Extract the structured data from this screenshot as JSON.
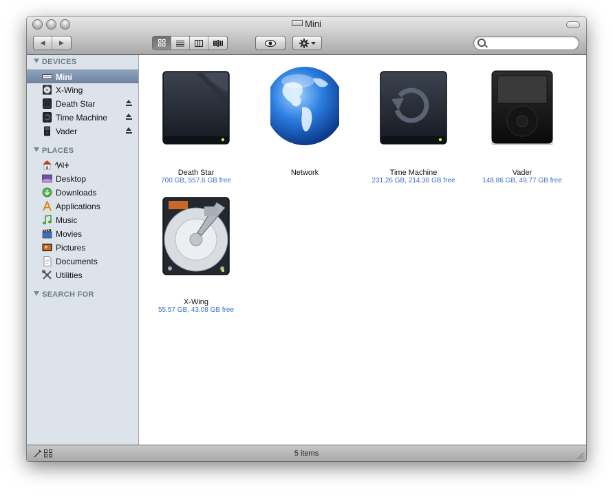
{
  "window": {
    "title": "Mini"
  },
  "toolbar": {
    "back_label": "◀",
    "forward_label": "▶",
    "views": [
      "icon-view",
      "list-view",
      "column-view",
      "coverflow-view"
    ],
    "quicklook_label": "Quick Look",
    "action_label": "Action",
    "search_placeholder": ""
  },
  "sidebar": {
    "devices_header": "DEVICES",
    "places_header": "PLACES",
    "search_header": "SEARCH FOR",
    "devices": [
      {
        "label": "Mini",
        "icon": "computer-icon",
        "selected": true,
        "eject": false
      },
      {
        "label": "X-Wing",
        "icon": "hard-disk-icon",
        "selected": false,
        "eject": false
      },
      {
        "label": "Death Star",
        "icon": "external-drive-icon",
        "selected": false,
        "eject": true
      },
      {
        "label": "Time Machine",
        "icon": "time-machine-drive-icon",
        "selected": false,
        "eject": true
      },
      {
        "label": "Vader",
        "icon": "ipod-icon",
        "selected": false,
        "eject": true
      }
    ],
    "places": [
      {
        "label": "",
        "icon": "home-icon"
      },
      {
        "label": "Desktop",
        "icon": "desktop-icon"
      },
      {
        "label": "Downloads",
        "icon": "downloads-icon"
      },
      {
        "label": "Applications",
        "icon": "applications-icon"
      },
      {
        "label": "Music",
        "icon": "music-icon"
      },
      {
        "label": "Movies",
        "icon": "movies-icon"
      },
      {
        "label": "Pictures",
        "icon": "pictures-icon"
      },
      {
        "label": "Documents",
        "icon": "documents-icon"
      },
      {
        "label": "Utilities",
        "icon": "utilities-icon"
      }
    ]
  },
  "items": [
    {
      "name": "Death Star",
      "info": "700 GB, 557.6 GB free",
      "icon": "external-drive-icon"
    },
    {
      "name": "Network",
      "info": "",
      "icon": "network-globe-icon"
    },
    {
      "name": "Time Machine",
      "info": "231.26 GB, 214.36 GB free",
      "icon": "time-machine-drive-icon"
    },
    {
      "name": "Vader",
      "info": "148.86 GB, 49.77 GB free",
      "icon": "ipod-icon"
    },
    {
      "name": "X-Wing",
      "info": "55.57 GB, 43.08 GB free",
      "icon": "hard-disk-icon"
    }
  ],
  "status": {
    "count": "5 items"
  },
  "colors": {
    "sidebar_bg": "#dce3ea",
    "selection": "#7c8fab",
    "info_text": "#3a6fc4"
  }
}
